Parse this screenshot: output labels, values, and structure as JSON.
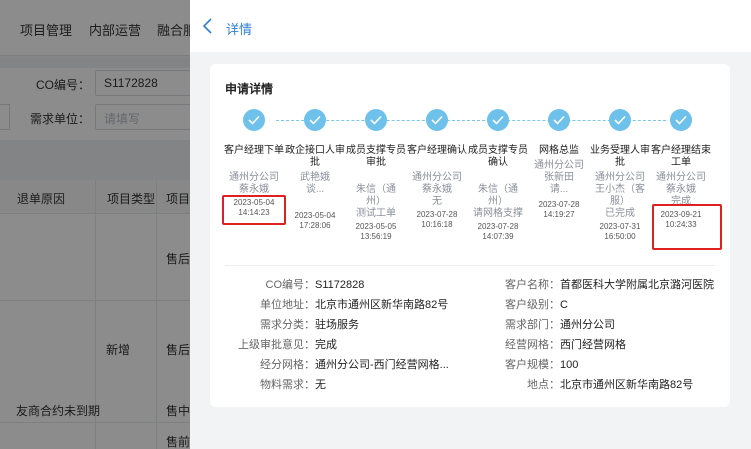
{
  "background": {
    "nav_items": [
      "项目管理",
      "内部运营",
      "融合服"
    ],
    "filters": {
      "co_label": "CO编号：",
      "co_value": "S1172828",
      "unit_label": "需求单位：",
      "unit_placeholder": "请填写"
    },
    "table": {
      "headers": [
        "退单原因",
        "项目类型",
        "项目"
      ],
      "cells": {
        "status_1": "售后",
        "type_2": "新增",
        "status_2": "售后",
        "reason_3": "友商合约未到期",
        "status_3": "售中",
        "status_4": "售前"
      }
    }
  },
  "drawer": {
    "title": "详情",
    "card_title": "申请详情",
    "steps": [
      {
        "name": "客户经理下单",
        "meta": [
          "通州分公司",
          "蔡永娥"
        ],
        "time": [
          "2023-05-04",
          "14:14:23"
        ]
      },
      {
        "name": "政企接口人审批",
        "meta": [
          "武艳娥",
          "谈..."
        ],
        "time": [
          "2023-05-04",
          "17:28:06"
        ]
      },
      {
        "name": "成员支撑专员审批",
        "meta": [
          "朱信（通",
          "州）",
          "测试工单"
        ],
        "time": [
          "2023-05-05",
          "13:56:19"
        ]
      },
      {
        "name": "客户经理确认",
        "meta": [
          "通州分公司",
          "蔡永娥",
          "无"
        ],
        "time": [
          "2023-07-28",
          "10:16:18"
        ]
      },
      {
        "name": "成员支撑专员确认",
        "meta": [
          "朱信（通",
          "州）",
          "请网格支撑"
        ],
        "time": [
          "2023-07-28",
          "14:07:39"
        ]
      },
      {
        "name": "网格总监",
        "meta": [
          "通州分公司",
          "张新田",
          "请..."
        ],
        "time": [
          "2023-07-28",
          "14:19:27"
        ]
      },
      {
        "name": "业务受理人审批",
        "meta": [
          "通州分公司",
          "王小杰（客",
          "服）",
          "已完成"
        ],
        "time": [
          "2023-07-31",
          "16:50:00"
        ]
      },
      {
        "name": "客户经理结束工单",
        "meta": [
          "通州分公司",
          "蔡永娥",
          "完成"
        ],
        "time": [
          "2023-09-21",
          "10:24:33"
        ]
      }
    ],
    "info_left": [
      {
        "label": "CO编号：",
        "value": "S1172828"
      },
      {
        "label": "单位地址：",
        "value": "北京市通州区新华南路82号"
      },
      {
        "label": "需求分类：",
        "value": "驻场服务"
      },
      {
        "label": "上级审批意见：",
        "value": "完成"
      },
      {
        "label": "经分网格：",
        "value": "通州分公司-西门经营网格..."
      },
      {
        "label": "物料需求：",
        "value": "无"
      }
    ],
    "info_right": [
      {
        "label": "客户名称：",
        "value": "首都医科大学附属北京潞河医院"
      },
      {
        "label": "客户级别：",
        "value": "C"
      },
      {
        "label": "需求部门：",
        "value": "通州分公司"
      },
      {
        "label": "经营网格：",
        "value": "西门经营网格"
      },
      {
        "label": "客户规模：",
        "value": "100"
      },
      {
        "label": "地点：",
        "value": "北京市通州区新华南路82号"
      }
    ]
  },
  "colors": {
    "accent": "#2f7fd6",
    "step_done": "#6ec1ea",
    "highlight": "#e02020"
  },
  "icons": {
    "back": "chevron-left-icon",
    "step": "check-icon"
  }
}
